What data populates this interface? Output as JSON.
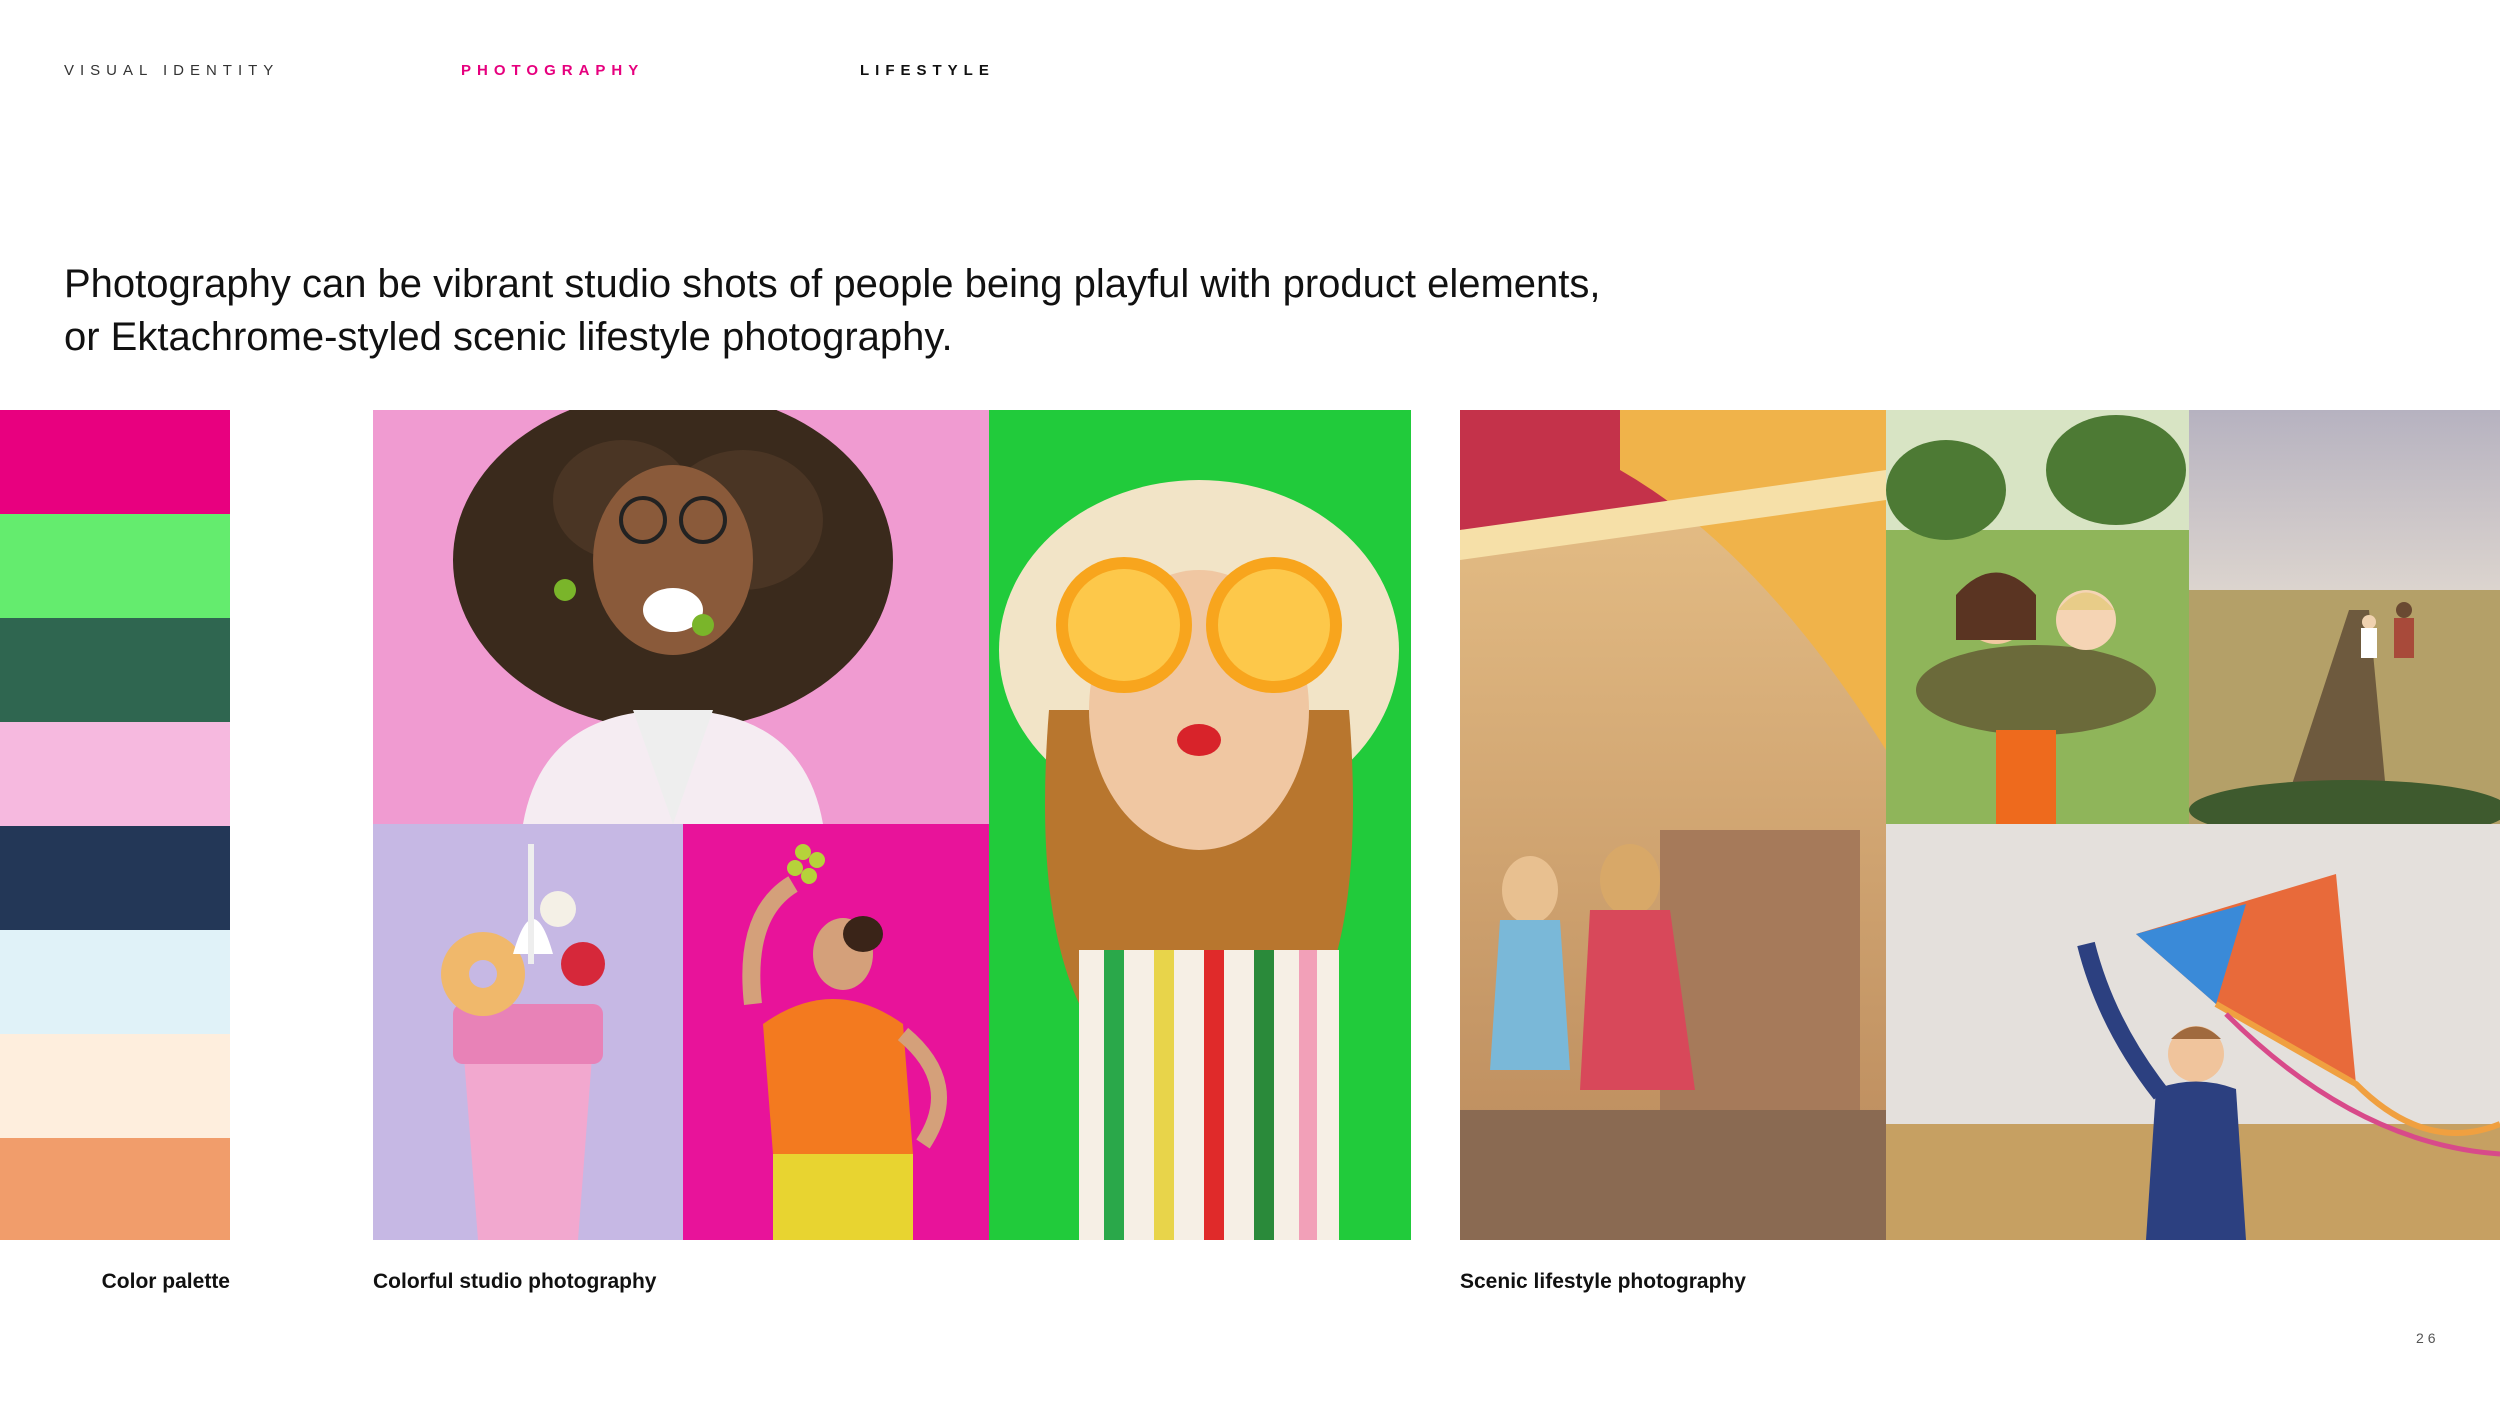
{
  "nav": {
    "items": [
      {
        "label": "VISUAL IDENTITY"
      },
      {
        "label": "PHOTOGRAPHY"
      },
      {
        "label": "LIFESTYLE"
      }
    ]
  },
  "headline": {
    "line1": "Photography can be vibrant studio shots of people being playful with product elements,",
    "line2": "or Ektachrome-styled scenic lifestyle photography."
  },
  "palette": {
    "colors": [
      "#e8007f",
      "#64ec6e",
      "#2f6650",
      "#f6b9df",
      "#233757",
      "#e0f2f8",
      "#feeedd",
      "#f19d6b"
    ],
    "caption": "Color palette"
  },
  "studio": {
    "caption": "Colorful studio photography"
  },
  "lifestyle": {
    "caption": "Scenic lifestyle photography"
  },
  "page_number": "26"
}
